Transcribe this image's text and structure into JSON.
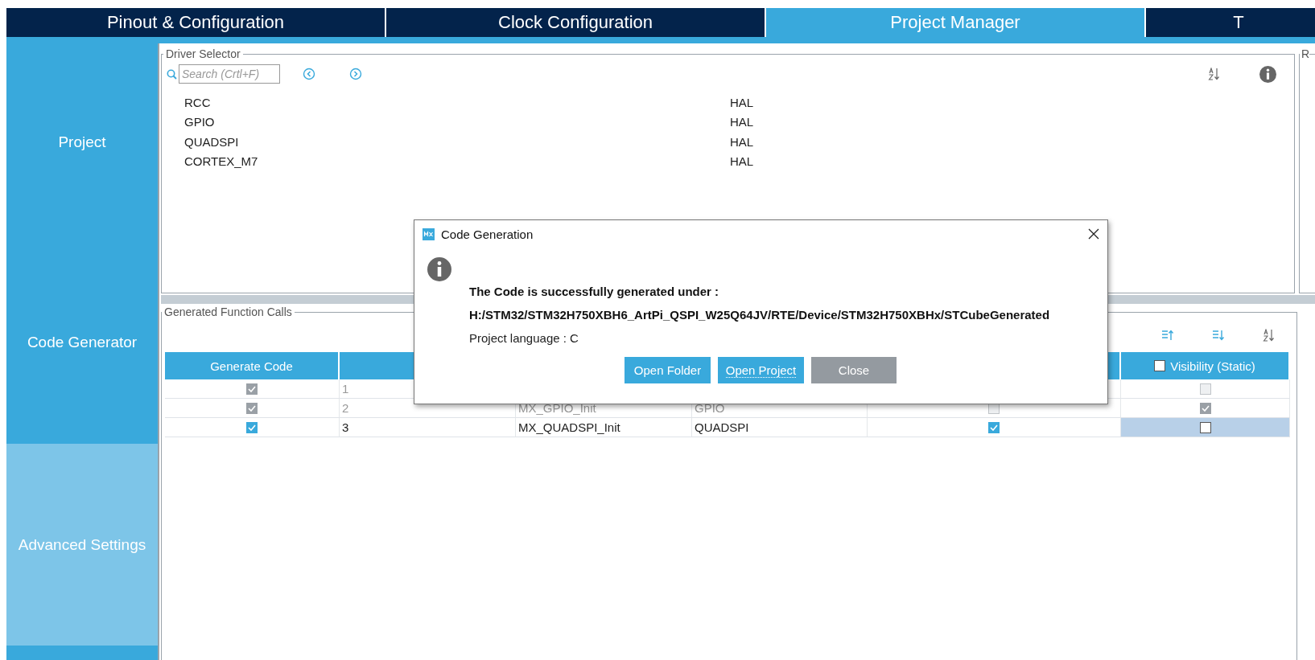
{
  "tabs": [
    {
      "label": "Pinout & Configuration",
      "selected": false
    },
    {
      "label": "Clock Configuration",
      "selected": false
    },
    {
      "label": "Project Manager",
      "selected": true
    },
    {
      "label": "T",
      "selected": false
    }
  ],
  "sidebar": {
    "items": [
      {
        "label": "Project",
        "selected": false
      },
      {
        "label": "Code Generator",
        "selected": false
      },
      {
        "label": "Advanced Settings",
        "selected": true
      }
    ]
  },
  "driver_selector": {
    "title": "Driver Selector",
    "search": {
      "placeholder": "Search (Crtl+F)"
    },
    "rows": [
      {
        "name": "RCC",
        "driver": "HAL"
      },
      {
        "name": "GPIO",
        "driver": "HAL"
      },
      {
        "name": "QUADSPI",
        "driver": "HAL"
      },
      {
        "name": "CORTEX_M7",
        "driver": "HAL"
      }
    ]
  },
  "right_panel": {
    "title": "R"
  },
  "function_calls": {
    "title": "Generated Function Calls",
    "header": {
      "generate_code": "Generate Code",
      "visibility": {
        "label": "Visibility (Static)",
        "checked": false
      }
    },
    "rows": [
      {
        "selected": false,
        "disabled": true,
        "generate": {
          "checked": true,
          "disabled": true
        },
        "rank": "1",
        "visibility": {
          "checked": false,
          "disabled": true
        }
      },
      {
        "selected": false,
        "disabled": true,
        "generate": {
          "checked": true,
          "disabled": true
        },
        "rank": "2",
        "function": "MX_GPIO_Init",
        "peripheral": "GPIO",
        "column_5": {
          "checked": false,
          "disabled": true
        },
        "visibility": {
          "checked": true,
          "disabled": true
        }
      },
      {
        "selected": true,
        "disabled": false,
        "generate": {
          "checked": true,
          "disabled": false
        },
        "rank": "3",
        "function": "MX_QUADSPI_Init",
        "peripheral": "QUADSPI",
        "column_5": {
          "checked": true,
          "disabled": false
        },
        "visibility": {
          "checked": false,
          "disabled": false
        }
      }
    ]
  },
  "dialog": {
    "title": "Code Generation",
    "message": "The Code is successfully generated under :",
    "path": "H:/STM32/STM32H750XBH6_ArtPi_QSPI_W25Q64JV/RTE/Device/STM32H750XBHx/STCubeGenerated",
    "language": "Project language : C",
    "buttons": [
      {
        "label": "Open Folder",
        "kind": "primary",
        "focused": false
      },
      {
        "label": "Open Project",
        "kind": "primary",
        "focused": true
      },
      {
        "label": "Close",
        "kind": "secondary",
        "focused": false
      }
    ]
  }
}
